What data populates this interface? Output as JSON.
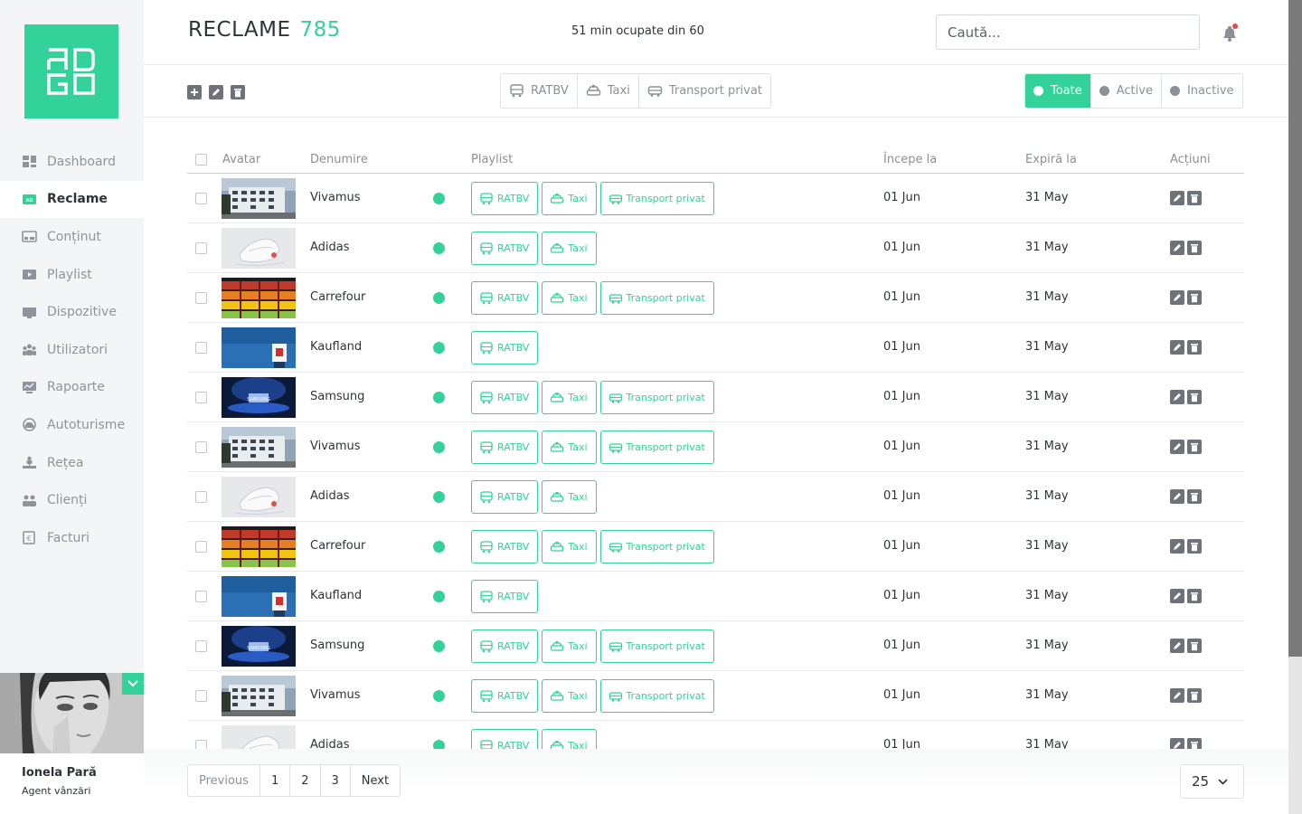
{
  "colors": {
    "accent": "#32d29a",
    "text": "#2e3338",
    "muted": "#8a9097",
    "notification": "#e5484d"
  },
  "logo": {
    "text": "ADGO"
  },
  "sidebar": {
    "items": [
      {
        "label": "Dashboard",
        "icon": "dashboard-icon"
      },
      {
        "label": "Reclame",
        "icon": "ad-icon",
        "active": true
      },
      {
        "label": "Conținut",
        "icon": "content-icon"
      },
      {
        "label": "Playlist",
        "icon": "playlist-icon"
      },
      {
        "label": "Dispozitive",
        "icon": "device-icon"
      },
      {
        "label": "Utilizatori",
        "icon": "users-icon"
      },
      {
        "label": "Rapoarte",
        "icon": "report-icon"
      },
      {
        "label": "Autoturisme",
        "icon": "car-icon"
      },
      {
        "label": "Rețea",
        "icon": "network-icon"
      },
      {
        "label": "Clienți",
        "icon": "clients-icon"
      },
      {
        "label": "Facturi",
        "icon": "invoice-icon"
      }
    ],
    "user": {
      "name": "Ionela Pară",
      "role": "Agent vânzări"
    }
  },
  "header": {
    "title": "RECLAME",
    "count": "785",
    "quota": "51 min ocupate din 60",
    "search_placeholder": "Caută..."
  },
  "toolbar": {
    "vehicle_filters": [
      "RATBV",
      "Taxi",
      "Transport privat"
    ],
    "status_filters": [
      {
        "label": "Toate",
        "active": true
      },
      {
        "label": "Active",
        "active": false
      },
      {
        "label": "Inactive",
        "active": false
      }
    ]
  },
  "table": {
    "headers": {
      "avatar": "Avatar",
      "name": "Denumire",
      "playlist": "Playlist",
      "start": "Începe la",
      "end": "Expiră la",
      "actions": "Acțiuni"
    },
    "rows": [
      {
        "avatar": "building",
        "name": "Vivamus",
        "playlists": [
          "RATBV",
          "Taxi",
          "Transport privat"
        ],
        "start": "01 Jun",
        "end": "31 May"
      },
      {
        "avatar": "sneakers",
        "name": "Adidas",
        "playlists": [
          "RATBV",
          "Taxi"
        ],
        "start": "01 Jun",
        "end": "31 May"
      },
      {
        "avatar": "produce",
        "name": "Carrefour",
        "playlists": [
          "RATBV",
          "Taxi",
          "Transport privat"
        ],
        "start": "01 Jun",
        "end": "31 May"
      },
      {
        "avatar": "store-sign",
        "name": "Kaufland",
        "playlists": [
          "RATBV"
        ],
        "start": "01 Jun",
        "end": "31 May"
      },
      {
        "avatar": "stage",
        "name": "Samsung",
        "playlists": [
          "RATBV",
          "Taxi",
          "Transport privat"
        ],
        "start": "01 Jun",
        "end": "31 May"
      },
      {
        "avatar": "building",
        "name": "Vivamus",
        "playlists": [
          "RATBV",
          "Taxi",
          "Transport privat"
        ],
        "start": "01 Jun",
        "end": "31 May"
      },
      {
        "avatar": "sneakers",
        "name": "Adidas",
        "playlists": [
          "RATBV",
          "Taxi"
        ],
        "start": "01 Jun",
        "end": "31 May"
      },
      {
        "avatar": "produce",
        "name": "Carrefour",
        "playlists": [
          "RATBV",
          "Taxi",
          "Transport privat"
        ],
        "start": "01 Jun",
        "end": "31 May"
      },
      {
        "avatar": "store-sign",
        "name": "Kaufland",
        "playlists": [
          "RATBV"
        ],
        "start": "01 Jun",
        "end": "31 May"
      },
      {
        "avatar": "stage",
        "name": "Samsung",
        "playlists": [
          "RATBV",
          "Taxi",
          "Transport privat"
        ],
        "start": "01 Jun",
        "end": "31 May"
      },
      {
        "avatar": "building",
        "name": "Vivamus",
        "playlists": [
          "RATBV",
          "Taxi",
          "Transport privat"
        ],
        "start": "01 Jun",
        "end": "31 May"
      },
      {
        "avatar": "sneakers",
        "name": "Adidas",
        "playlists": [
          "RATBV",
          "Taxi"
        ],
        "start": "01 Jun",
        "end": "31 May"
      }
    ]
  },
  "pagination": {
    "previous": "Previous",
    "pages": [
      "1",
      "2",
      "3"
    ],
    "next": "Next",
    "per_page": "25"
  }
}
